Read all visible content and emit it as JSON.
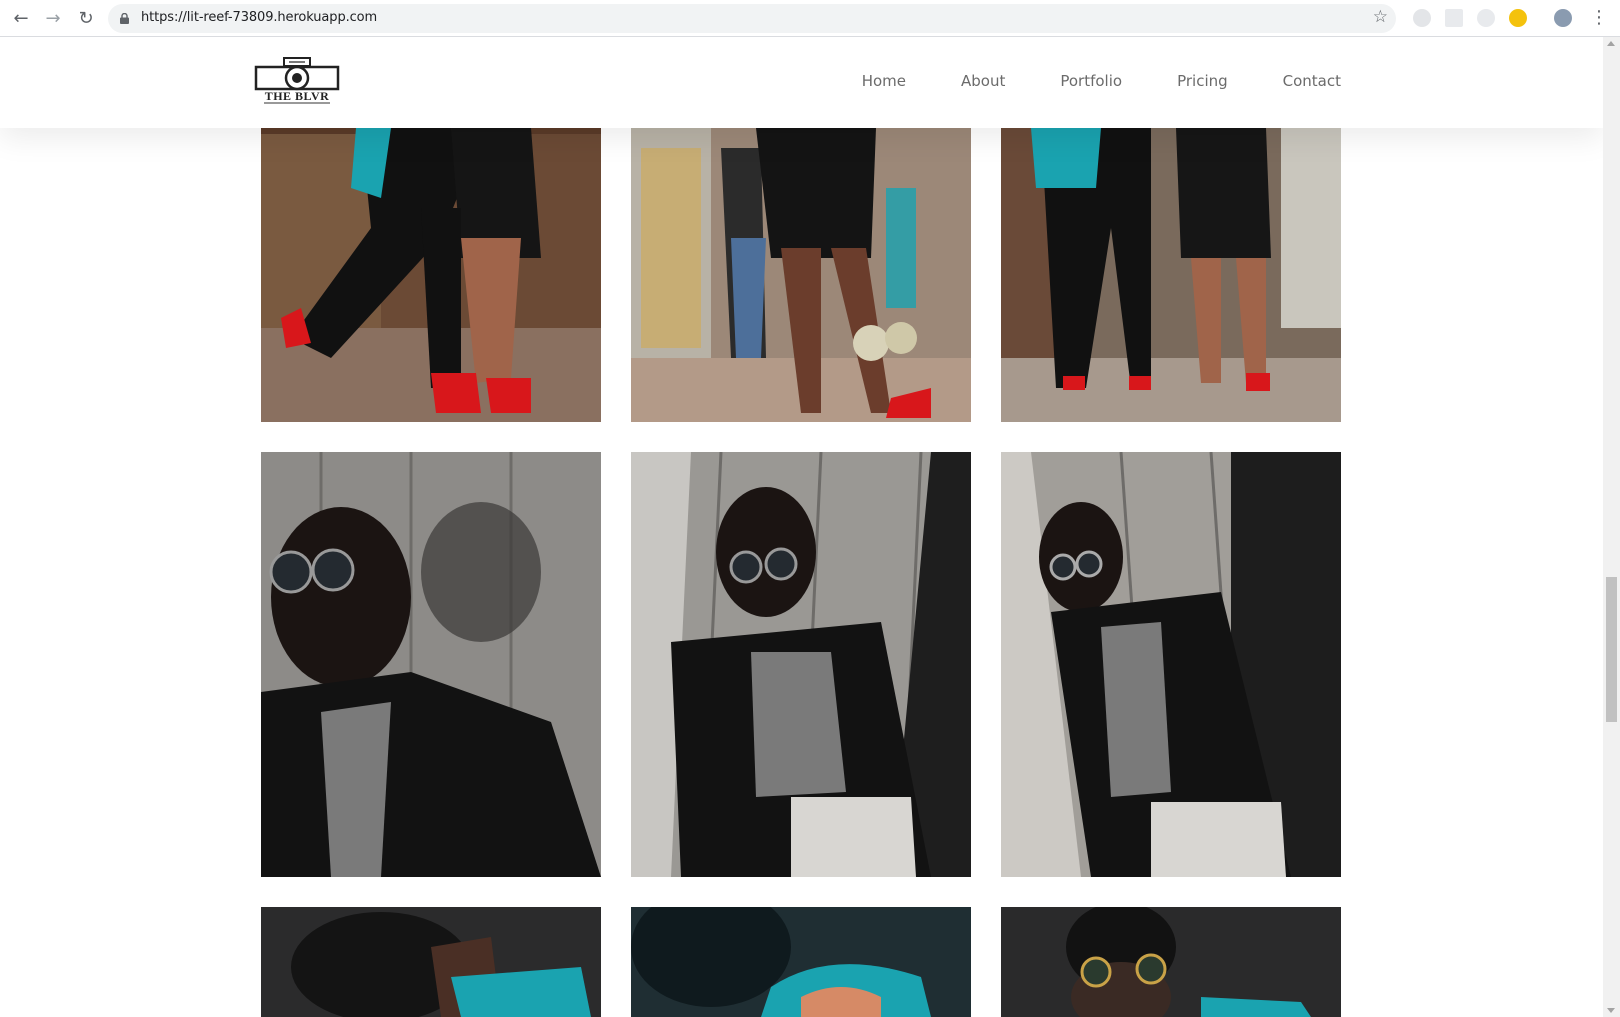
{
  "browser": {
    "url": "https://lit-reef-73809.herokuapp.com",
    "icons": [
      "back-icon",
      "forward-icon",
      "reload-icon",
      "lock-icon",
      "star-icon",
      "menu-icon"
    ]
  },
  "site": {
    "logo_text": "THE BLVR",
    "nav": [
      {
        "label": "Home"
      },
      {
        "label": "About"
      },
      {
        "label": "Portfolio"
      },
      {
        "label": "Pricing"
      },
      {
        "label": "Contact"
      }
    ]
  },
  "gallery": {
    "rows": [
      {
        "name": "row-1",
        "photos": [
          "street-fashion-duo-1",
          "street-fashion-market",
          "street-fashion-duo-2"
        ]
      },
      {
        "name": "row-2",
        "photos": [
          "leather-jacket-portrait-1",
          "leather-jacket-portrait-2",
          "leather-jacket-portrait-3"
        ]
      },
      {
        "name": "row-3",
        "photos": [
          "cap-portrait",
          "teal-scarf-portrait",
          "sunglasses-portrait"
        ]
      }
    ]
  },
  "colors": {
    "nav_text": "#6b6b6b",
    "accent_red": "#d8171b",
    "teal": "#1aa3b0"
  }
}
